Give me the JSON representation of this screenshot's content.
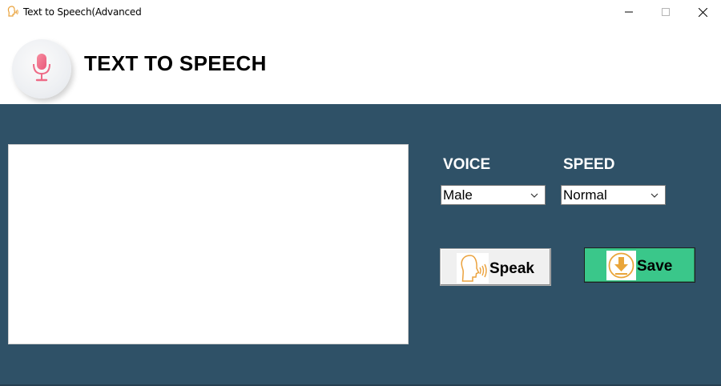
{
  "window": {
    "title": "Text to Speech(Advanced",
    "controls": [
      "minimize",
      "maximize",
      "close"
    ]
  },
  "header": {
    "title": "TEXT TO SPEECH",
    "icon": "microphone-icon"
  },
  "form": {
    "text_value": "",
    "voice_label": "VOICE",
    "voice_value": "Male",
    "speed_label": "SPEED",
    "speed_value": "Normal",
    "speak_label": "Speak",
    "speak_icon": "speaking-head-icon",
    "save_label": "Save",
    "save_icon": "download-icon"
  },
  "colors": {
    "panel_bg": "#2f5167",
    "save_button": "#3ac78a",
    "speak_button": "#f0f0f0",
    "mic_accent": "#f06d86"
  }
}
